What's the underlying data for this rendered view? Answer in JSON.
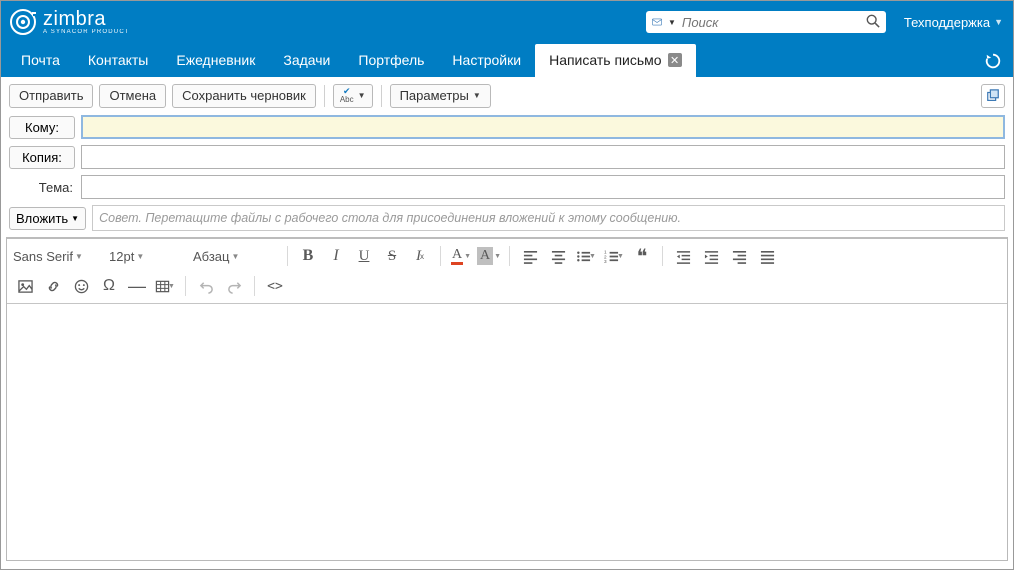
{
  "header": {
    "logo_name": "zimbra",
    "logo_sub": "A SYNACOR PRODUCT",
    "search_placeholder": "Поиск",
    "support_label": "Техподдержка"
  },
  "tabs": {
    "items": [
      {
        "label": "Почта"
      },
      {
        "label": "Контакты"
      },
      {
        "label": "Ежедневник"
      },
      {
        "label": "Задачи"
      },
      {
        "label": "Портфель"
      },
      {
        "label": "Настройки"
      }
    ],
    "active": {
      "label": "Написать письмо"
    }
  },
  "toolbar": {
    "send": "Отправить",
    "cancel": "Отмена",
    "save_draft": "Сохранить черновик",
    "options": "Параметры"
  },
  "fields": {
    "to_label": "Кому:",
    "cc_label": "Копия:",
    "subject_label": "Тема:",
    "attach_label": "Вложить",
    "attach_hint": "Совет. Перетащите файлы с рабочего стола для присоединения вложений к этому сообщению.",
    "to_value": "",
    "cc_value": "",
    "subject_value": ""
  },
  "editor": {
    "font_family": "Sans Serif",
    "font_size": "12pt",
    "block_format": "Абзац"
  }
}
